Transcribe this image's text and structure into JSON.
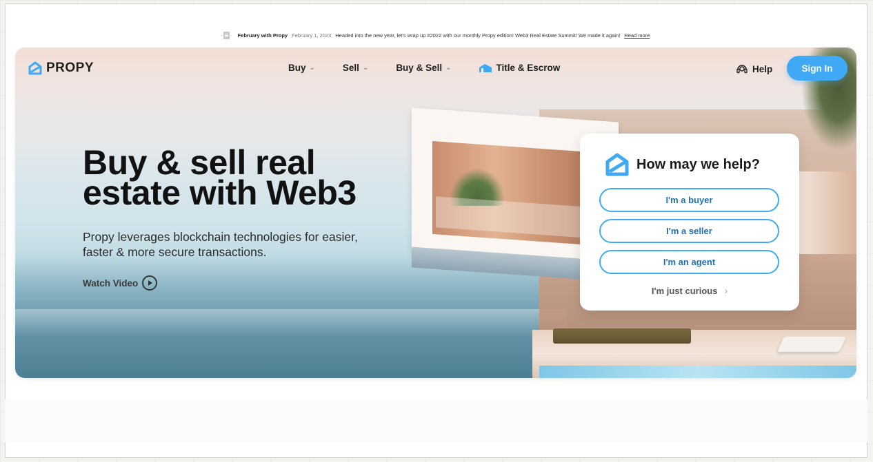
{
  "announcement": {
    "title": "February with Propy",
    "date": "February 1, 2023",
    "text": "Headed into the new year, let's wrap up #2022 with our monthly Propy edition! Web3 Real Estate Summit! We made it again!",
    "link": "Read more"
  },
  "nav": {
    "logo": "PROPY",
    "menu": [
      {
        "label": "Buy",
        "icon": "chevron-down-icon"
      },
      {
        "label": "Sell",
        "icon": "chevron-down-icon"
      },
      {
        "label": "Buy & Sell",
        "icon": "chevron-down-icon"
      },
      {
        "label": "Title & Escrow",
        "icon": "title-escrow-icon"
      }
    ],
    "help": "Help",
    "signin": "Sign In"
  },
  "hero": {
    "headline": "Buy & sell real estate with Web3",
    "subtext": "Propy leverages blockchain technologies for easier, faster & more secure transactions.",
    "watch": "Watch Video"
  },
  "help_card": {
    "title": "How may we help?",
    "options": [
      "I'm a buyer",
      "I'm a seller",
      "I'm an agent"
    ],
    "curious": "I'm just curious"
  },
  "colors": {
    "accent": "#3fa9f5",
    "text": "#111111"
  }
}
